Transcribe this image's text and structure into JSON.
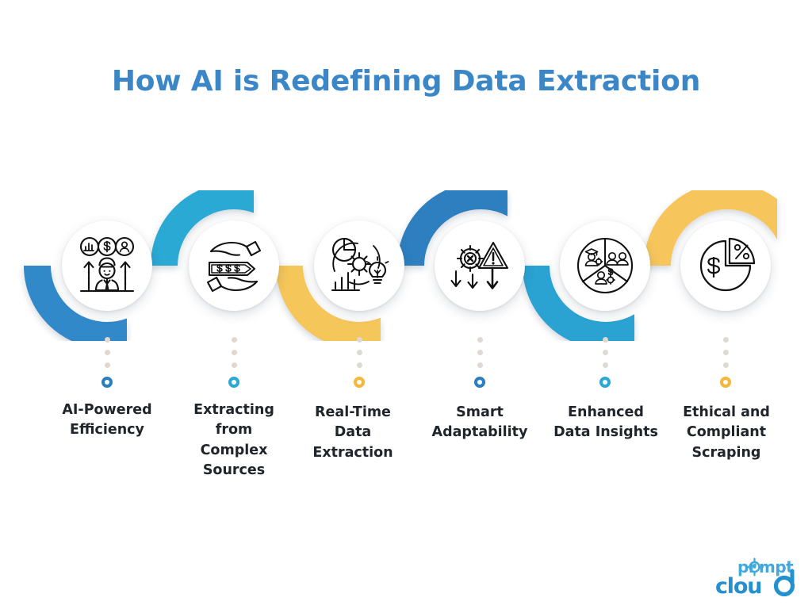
{
  "page": {
    "title": "How AI is Redefining Data Extraction",
    "background_color": "#ffffff",
    "title_color": "#3b86c6"
  },
  "palette": {
    "blue_dark": "#2d7fc0",
    "blue_mid": "#3189c9",
    "cyan": "#29a9d4",
    "cyan_alt": "#29a3d2",
    "yellow": "#f5c65a",
    "yellow_alt": "#f6c65c",
    "dot_gray": "#dedad3",
    "label_text": "#20242b",
    "icon_stroke": "#111111"
  },
  "steps": [
    {
      "index": 1,
      "label": "AI-Powered\nEfficiency",
      "icon": "ai-efficiency-icon",
      "marker_color": "#2b7fc0",
      "arc_color": "#3189c9",
      "arc_direction": "down"
    },
    {
      "index": 2,
      "label": "Extracting\nfrom\nComplex\nSources",
      "icon": "hands-price-tag-icon",
      "marker_color": "#29a9d4",
      "arc_color": "#29a9d4",
      "arc_direction": "up"
    },
    {
      "index": 3,
      "label": "Real-Time\nData\nExtraction",
      "icon": "gear-lightbulb-analytics-icon",
      "marker_color": "#f5b63a",
      "arc_color": "#f5c65a",
      "arc_direction": "down"
    },
    {
      "index": 4,
      "label": "Smart\nAdaptability",
      "icon": "gear-warning-arrows-icon",
      "marker_color": "#2b7fc0",
      "arc_color": "#2d7fc0",
      "arc_direction": "up"
    },
    {
      "index": 5,
      "label": "Enhanced\nData Insights",
      "icon": "pie-people-segments-icon",
      "marker_color": "#29a9d4",
      "arc_color": "#29a3d2",
      "arc_direction": "down"
    },
    {
      "index": 6,
      "label": "Ethical and\nCompliant\nScraping",
      "icon": "pie-dollar-percent-icon",
      "marker_color": "#f5b63a",
      "arc_color": "#f6c65c",
      "arc_direction": "up"
    }
  ],
  "logo": {
    "word_top": "prompt",
    "word_bottom": "cloud",
    "color_top": "#3fa9dd",
    "color_bottom": "#2390cf"
  }
}
